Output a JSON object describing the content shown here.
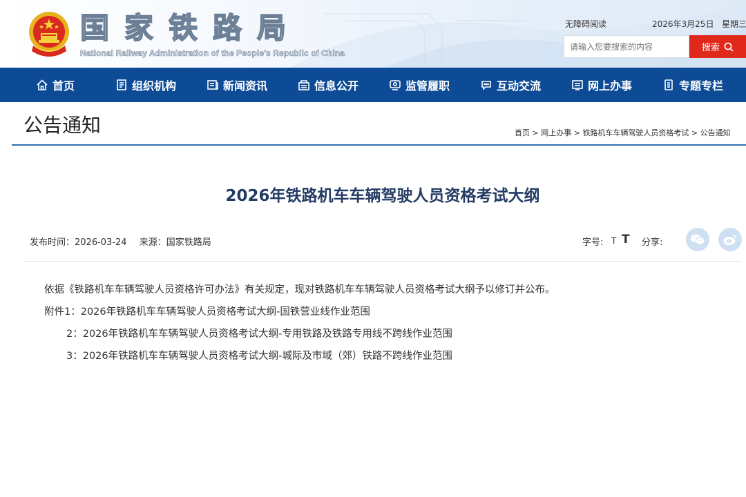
{
  "header": {
    "site_name_cn": "国家铁路局",
    "site_name_en": "National Railway Administration of the People's Republic of China",
    "accessibility": "无障碍阅读",
    "date": "2026年3月25日",
    "weekday": "星期三",
    "search_placeholder": "请输入您要搜索的内容",
    "search_button": "搜索",
    "accent_color": "#e0281b"
  },
  "nav": {
    "background": "#0e4b96",
    "items": [
      {
        "label": "首页",
        "icon": "home-icon"
      },
      {
        "label": "组织机构",
        "icon": "org-icon"
      },
      {
        "label": "新闻资讯",
        "icon": "news-icon"
      },
      {
        "label": "信息公开",
        "icon": "info-icon"
      },
      {
        "label": "监管履职",
        "icon": "monitor-icon"
      },
      {
        "label": "互动交流",
        "icon": "chat-icon"
      },
      {
        "label": "网上办事",
        "icon": "service-icon"
      },
      {
        "label": "专题专栏",
        "icon": "topic-icon"
      }
    ]
  },
  "page": {
    "section_title": "公告通知",
    "breadcrumb": [
      "首页",
      "网上办事",
      "铁路机车车辆驾驶人员资格考试",
      "公告通知"
    ],
    "breadcrumb_sep": ">"
  },
  "article": {
    "title": "2026年铁路机车车辆驾驶人员资格考试大纲",
    "publish_label": "发布时间：",
    "publish_date": "2026-03-24",
    "source_label": "来源：",
    "source": "国家铁路局",
    "font_size_label": "字号:",
    "font_small": "T",
    "font_large": "T",
    "share_label": "分享:",
    "share_icons": [
      "wechat-icon",
      "weibo-icon"
    ],
    "intro": "依据《铁路机车车辆驾驶人员资格许可办法》有关规定，现对铁路机车车辆驾驶人员资格考试大纲予以修订并公布。",
    "attachments_label": "附件1：",
    "attachments": [
      {
        "prefix": "附件1：",
        "text": "2026年铁路机车车辆驾驶人员资格考试大纲-国铁营业线作业范围"
      },
      {
        "prefix": "2：",
        "text": "2026年铁路机车车辆驾驶人员资格考试大纲-专用铁路及铁路专用线不跨线作业范围"
      },
      {
        "prefix": "3：",
        "text": "2026年铁路机车车辆驾驶人员资格考试大纲-城际及市域（郊）铁路不跨线作业范围"
      }
    ]
  }
}
